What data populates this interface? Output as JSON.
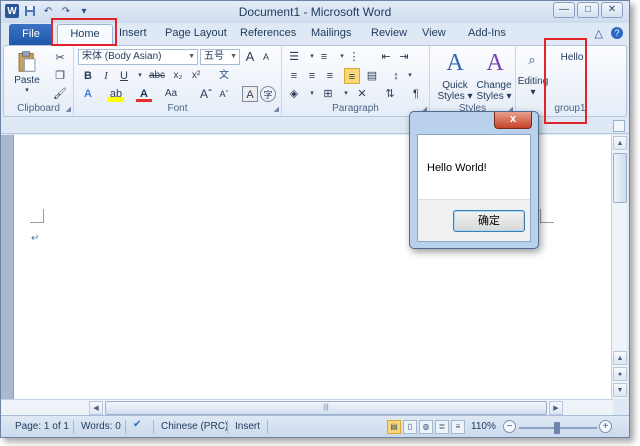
{
  "window": {
    "title": "Document1 - Microsoft Word"
  },
  "qat": {
    "word_icon": "W",
    "save_icon": "save-icon",
    "undo_icon": "undo-icon",
    "redo_icon": "redo-icon",
    "customize_icon": "customize-icon"
  },
  "window_buttons": {
    "minimize": "—",
    "restore": "□",
    "close": "✕"
  },
  "tabs": {
    "file": "File",
    "items": [
      "Home",
      "Insert",
      "Page Layout",
      "References",
      "Mailings",
      "Review",
      "View",
      "Add-Ins"
    ]
  },
  "ribbon": {
    "clipboard": {
      "label": "Clipboard",
      "paste": "Paste"
    },
    "font": {
      "label": "Font",
      "font_name": "宋体 (Body Asian)",
      "font_size": "五号",
      "font_size_grow": "A",
      "font_size_shrink": "A",
      "bold": "B",
      "italic": "I",
      "underline": "U",
      "strike": "abc",
      "subscript": "x₂",
      "superscript": "x²",
      "change_case": "Aa",
      "char_border": "A",
      "enclose": "字",
      "phonetic": "文"
    },
    "paragraph": {
      "label": "Paragraph"
    },
    "styles": {
      "label": "Styles",
      "quick": "Quick",
      "quick2": "Styles",
      "change": "Change",
      "change2": "Styles"
    },
    "editing": {
      "label": "Editing"
    },
    "group1": {
      "label": "group1",
      "hello": "Hello"
    }
  },
  "document": {
    "paragraph_mark": "↵"
  },
  "dialog": {
    "close": "x",
    "message": "Hello World!",
    "ok": "确定"
  },
  "status": {
    "page": "Page: 1 of 1",
    "words": "Words: 0",
    "language": "Chinese (PRC)",
    "mode": "Insert",
    "zoom": "110%",
    "zoom_minus": "−",
    "zoom_plus": "+"
  },
  "colors": {
    "accent": "#2a5699",
    "highlight": "#f8d776",
    "red_annotation": "#e0242a"
  }
}
